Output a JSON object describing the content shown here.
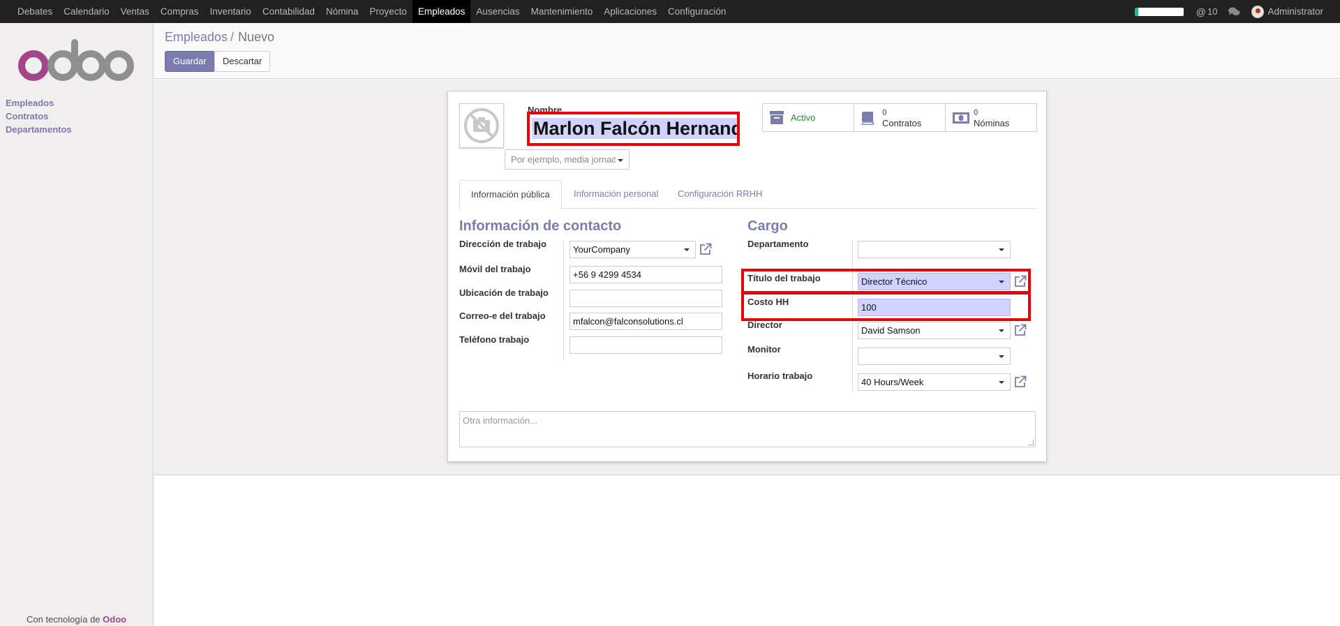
{
  "topbar": {
    "menu": [
      "Debates",
      "Calendario",
      "Ventas",
      "Compras",
      "Inventario",
      "Contabilidad",
      "Nómina",
      "Proyecto",
      "Empleados",
      "Ausencias",
      "Mantenimiento",
      "Aplicaciones",
      "Configuración"
    ],
    "active_menu": "Empleados",
    "progress_fraction": 0.07,
    "mentions_count": "10",
    "user_name": "Administrator"
  },
  "sidebar": {
    "logo_text": "odoo",
    "items": [
      "Empleados",
      "Contratos",
      "Departamentos"
    ],
    "powered_by_prefix": "Con tecnología de",
    "powered_by_brand": "Odoo"
  },
  "control_panel": {
    "breadcrumb_parent": "Empleados",
    "breadcrumb_separator": "/",
    "breadcrumb_current": "Nuevo",
    "save_label": "Guardar",
    "discard_label": "Descartar"
  },
  "form": {
    "name_label": "Nombre",
    "name_value": "Marlon Falcón Hernandez",
    "category_placeholder": "Por ejemplo, media jornada",
    "stat_buttons": {
      "active_label": "Activo",
      "contracts_count": "0",
      "contracts_label": "Contratos",
      "payslips_count": "0",
      "payslips_label": "Nóminas"
    },
    "tabs": [
      "Información pública",
      "Información personal",
      "Configuración RRHH"
    ],
    "contact": {
      "title": "Información de contacto",
      "work_address_label": "Dirección de trabajo",
      "work_address_value": "YourCompany",
      "mobile_label": "Móvil del trabajo",
      "mobile_value": "+56 9 4299 4534",
      "location_label": "Ubicación de trabajo",
      "location_value": "",
      "email_label": "Correo-e del trabajo",
      "email_value": "mfalcon@falconsolutions.cl",
      "phone_label": "Teléfono trabajo",
      "phone_value": ""
    },
    "position": {
      "title": "Cargo",
      "department_label": "Departamento",
      "department_value": "",
      "job_title_label": "Título del trabajo",
      "job_title_value": "Director Técnico",
      "cost_label": "Costo HH",
      "cost_value": "100",
      "manager_label": "Director",
      "manager_value": "David Samson",
      "coach_label": "Monitor",
      "coach_value": "",
      "schedule_label": "Horario trabajo",
      "schedule_value": "40 Hours/Week"
    },
    "notes_placeholder": "Otra información..."
  }
}
